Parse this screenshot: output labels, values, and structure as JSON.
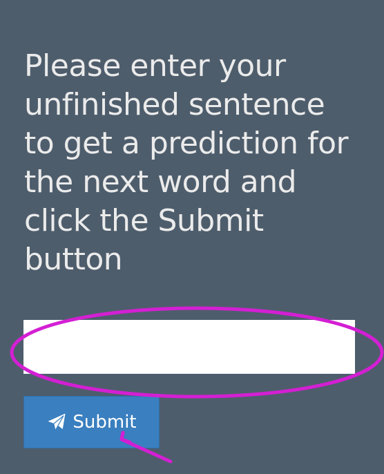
{
  "form": {
    "instruction": "Please enter your unfinished sentence to get a prediction for the next word and click the Submit button",
    "input_value": "",
    "submit_label": "Submit",
    "submit_icon": "paper-plane-icon"
  },
  "colors": {
    "background": "#4e5d6c",
    "text": "#ebebeb",
    "button": "#3a7fbf",
    "annotation": "#d31fd3"
  }
}
